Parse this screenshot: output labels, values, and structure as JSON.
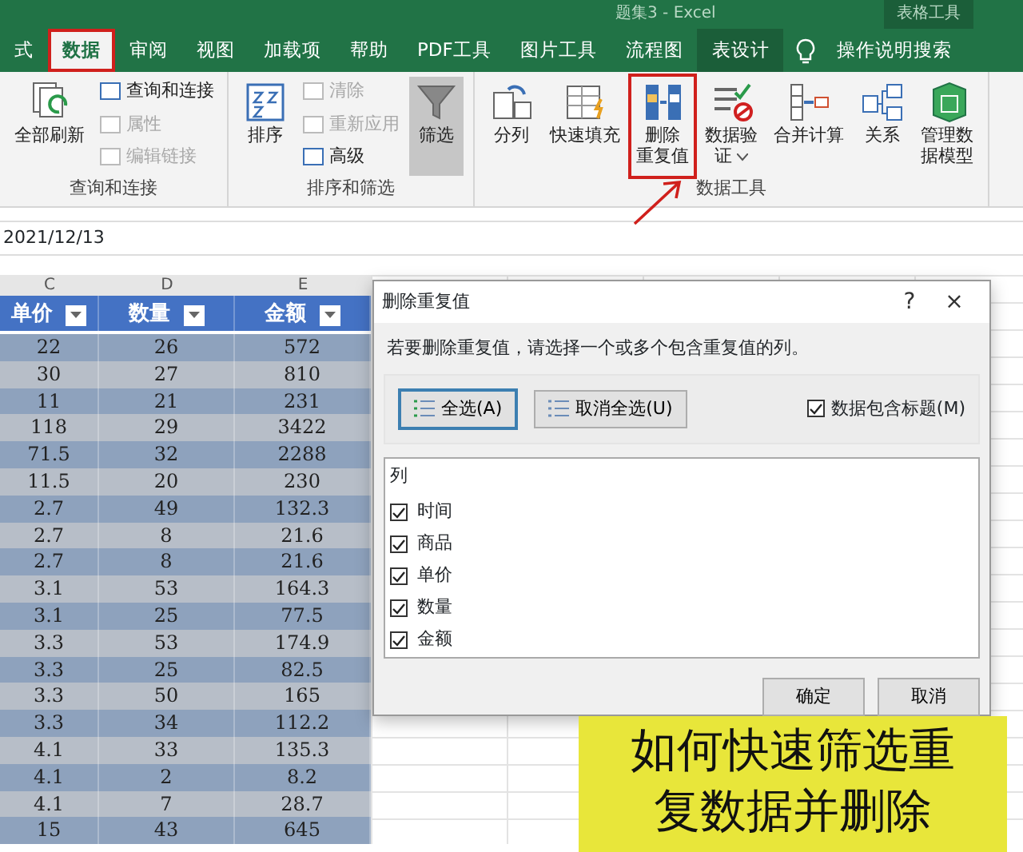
{
  "window": {
    "title": "题集3  -  Excel",
    "context_title": "表格工具"
  },
  "tabs": [
    {
      "label": "式",
      "selected": false
    },
    {
      "label": "数据",
      "selected": true
    },
    {
      "label": "审阅",
      "selected": false
    },
    {
      "label": "视图",
      "selected": false
    },
    {
      "label": "加载项",
      "selected": false
    },
    {
      "label": "帮助",
      "selected": false
    },
    {
      "label": "PDF工具",
      "selected": false
    },
    {
      "label": "图片工具",
      "selected": false
    },
    {
      "label": "流程图",
      "selected": false
    },
    {
      "label": "表设计",
      "selected": false
    }
  ],
  "search": {
    "label": "操作说明搜索"
  },
  "ribbon_groups": [
    {
      "label": "查询和连接",
      "big": [
        {
          "lines": [
            "全部刷新"
          ],
          "kind": "refresh",
          "disabled": false,
          "selected": false
        }
      ],
      "small": [
        {
          "label": "查询和连接",
          "disabled": false
        },
        {
          "label": "属性",
          "disabled": true
        },
        {
          "label": "编辑链接",
          "disabled": true
        }
      ]
    },
    {
      "label": "排序和筛选",
      "big": [
        {
          "lines": [
            "排序"
          ],
          "kind": "sort",
          "disabled": false,
          "selected": false
        },
        {
          "lines": [
            "筛选"
          ],
          "kind": "filter",
          "disabled": false,
          "selected": true
        }
      ],
      "small": [
        {
          "label": "清除",
          "disabled": true
        },
        {
          "label": "重新应用",
          "disabled": true
        },
        {
          "label": "高级",
          "disabled": false
        }
      ]
    },
    {
      "label": "数据工具",
      "big": [
        {
          "lines": [
            "分列"
          ],
          "kind": "split",
          "disabled": false,
          "selected": false
        },
        {
          "lines": [
            "快速填充"
          ],
          "kind": "flash",
          "disabled": false,
          "selected": false
        },
        {
          "lines": [
            "删除",
            "重复值"
          ],
          "kind": "dedupe",
          "disabled": false,
          "selected": false,
          "highlighted": true
        },
        {
          "lines": [
            "数据验",
            "证"
          ],
          "kind": "validate",
          "disabled": false,
          "selected": false,
          "dropdown": true
        },
        {
          "lines": [
            "合并计算"
          ],
          "kind": "merge",
          "disabled": false,
          "selected": false
        },
        {
          "lines": [
            "关系"
          ],
          "kind": "relation",
          "disabled": false,
          "selected": false
        },
        {
          "lines": [
            "管理数",
            "据模型"
          ],
          "kind": "model",
          "disabled": false,
          "selected": false
        }
      ]
    }
  ],
  "formula_bar": {
    "value": "2021/12/13"
  },
  "sheet": {
    "column_letters": [
      "C",
      "D",
      "E"
    ],
    "headers": [
      "单价",
      "数量",
      "金额"
    ],
    "rows": [
      [
        "22",
        "26",
        "572"
      ],
      [
        "30",
        "27",
        "810"
      ],
      [
        "11",
        "21",
        "231"
      ],
      [
        "118",
        "29",
        "3422"
      ],
      [
        "71.5",
        "32",
        "2288"
      ],
      [
        "11.5",
        "20",
        "230"
      ],
      [
        "2.7",
        "49",
        "132.3"
      ],
      [
        "2.7",
        "8",
        "21.6"
      ],
      [
        "2.7",
        "8",
        "21.6"
      ],
      [
        "3.1",
        "53",
        "164.3"
      ],
      [
        "3.1",
        "25",
        "77.5"
      ],
      [
        "3.3",
        "53",
        "174.9"
      ],
      [
        "3.3",
        "25",
        "82.5"
      ],
      [
        "3.3",
        "50",
        "165"
      ],
      [
        "3.3",
        "34",
        "112.2"
      ],
      [
        "4.1",
        "33",
        "135.3"
      ],
      [
        "4.1",
        "2",
        "8.2"
      ],
      [
        "4.1",
        "7",
        "28.7"
      ],
      [
        "15",
        "43",
        "645"
      ]
    ]
  },
  "dialog": {
    "title": "删除重复值",
    "help": "?",
    "close": "×",
    "instruction": "若要删除重复值，请选择一个或多个包含重复值的列。",
    "select_all": "全选(A)",
    "unselect_all": "取消全选(U)",
    "has_headers": {
      "label": "数据包含标题(M)",
      "checked": true
    },
    "list_header": "列",
    "columns": [
      {
        "label": "时间",
        "checked": true
      },
      {
        "label": "商品",
        "checked": true
      },
      {
        "label": "单价",
        "checked": true
      },
      {
        "label": "数量",
        "checked": true
      },
      {
        "label": "金额",
        "checked": true
      }
    ],
    "ok": "确定",
    "cancel": "取消"
  },
  "overlay_text": [
    "如何快速筛选重",
    "复数据并删除"
  ]
}
